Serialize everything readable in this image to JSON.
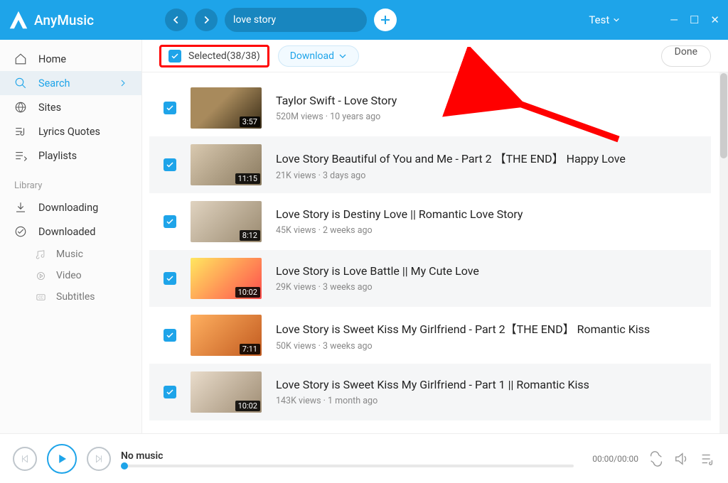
{
  "app": {
    "name": "AnyMusic"
  },
  "topbar": {
    "search_value": "love story",
    "test_label": "Test"
  },
  "sidebar": {
    "items": [
      {
        "label": "Home"
      },
      {
        "label": "Search"
      },
      {
        "label": "Sites"
      },
      {
        "label": "Lyrics Quotes"
      },
      {
        "label": "Playlists"
      }
    ],
    "library_label": "Library",
    "library_items": [
      {
        "label": "Downloading"
      },
      {
        "label": "Downloaded"
      }
    ],
    "sub_items": [
      {
        "label": "Music"
      },
      {
        "label": "Video"
      },
      {
        "label": "Subtitles"
      }
    ]
  },
  "actions": {
    "selected_label": "Selected(38/38)",
    "download_label": "Download",
    "done_label": "Done"
  },
  "results": [
    {
      "title": "Taylor Swift - Love Story",
      "meta": "520M views · 10 years ago",
      "duration": "3:57"
    },
    {
      "title": "Love Story Beautiful of You and Me - Part 2 【THE END】 Happy Love",
      "meta": "21K views · 3 days ago",
      "duration": "11:15"
    },
    {
      "title": "Love Story is Destiny Love || Romantic Love Story",
      "meta": "45K views · 2 weeks ago",
      "duration": "8:12"
    },
    {
      "title": "Love Story is Love Battle || My Cute Love",
      "meta": "29K views · 3 weeks ago",
      "duration": "10:02"
    },
    {
      "title": "Love Story is Sweet Kiss My Girlfriend - Part 2【THE END】 Romantic Kiss",
      "meta": "50K views · 3 weeks ago",
      "duration": "7:11"
    },
    {
      "title": "Love Story is Sweet Kiss My Girlfriend - Part 1 || Romantic Kiss",
      "meta": "143K views · 1 month ago",
      "duration": "10:02"
    }
  ],
  "player": {
    "track": "No music",
    "time": "00:00/00:00"
  }
}
